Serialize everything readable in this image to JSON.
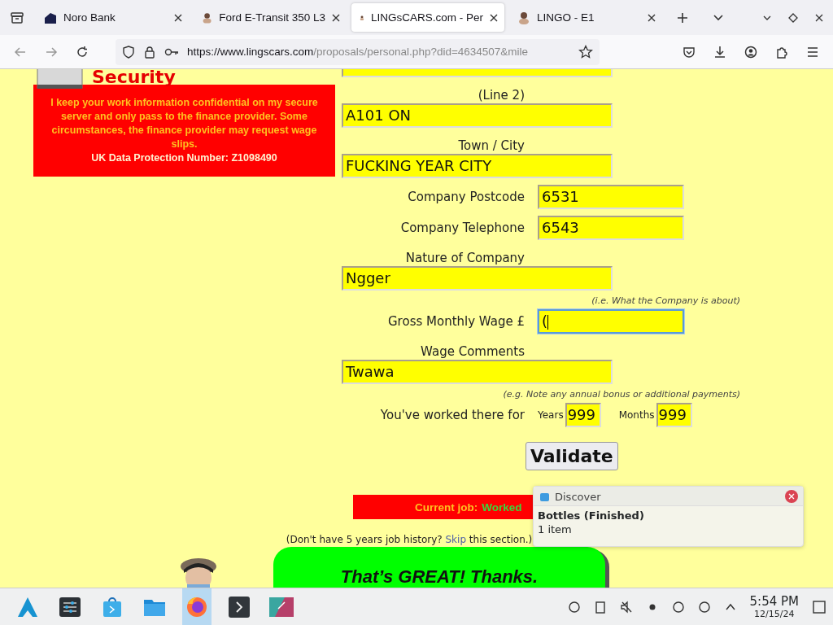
{
  "browser": {
    "tabs": [
      {
        "title": "Noro Bank",
        "selected": false
      },
      {
        "title": "Ford E-Transit 350 L3",
        "selected": false
      },
      {
        "title": "LINGsCARS.com - Per",
        "selected": true
      },
      {
        "title": "LINGO - E1",
        "selected": false
      }
    ],
    "url": {
      "host": "https://www.lingscars.com",
      "path": "/proposals/personal.php?did=4634507&mile"
    }
  },
  "security": {
    "heading": "Security",
    "text": "I keep your work information confidential on my secure server and only pass to the finance provider. Some circumstances, the finance provider may request wage slips.",
    "dp_number": "UK Data Protection Number: Z1098490"
  },
  "fields": [
    {
      "kind": "cut"
    },
    {
      "kind": "stacked",
      "label": "(Line 2)",
      "value": "A101 ON",
      "focused": false
    },
    {
      "kind": "stacked",
      "label": "Town / City",
      "value": "FUCKING YEAR CITY",
      "focused": false
    },
    {
      "kind": "inline",
      "label": "Company Postcode",
      "value": "6531",
      "focused": false
    },
    {
      "kind": "inline",
      "label": "Company Telephone",
      "value": "6543",
      "focused": false
    },
    {
      "kind": "stacked",
      "label": "Nature of Company",
      "value": "Ngger",
      "focused": false
    },
    {
      "kind": "hint",
      "text": "(i.e. What the Company is about)"
    },
    {
      "kind": "inline",
      "label": "Gross Monthly Wage £",
      "value": "(",
      "focused": true
    },
    {
      "kind": "stacked",
      "label": "Wage Comments",
      "value": "Twawa",
      "focused": false
    },
    {
      "kind": "hint",
      "text": "(e.g. Note any annual bonus or additional payments)"
    }
  ],
  "duration": {
    "label": "You've worked there for",
    "years_label": "Years",
    "years": "999",
    "months_label": "Months",
    "months": "999"
  },
  "validate_button": "Validate",
  "current_job": {
    "label": "Current job:",
    "value": "Worked"
  },
  "skip_note": {
    "before": "(Don't have 5 years job history?",
    "link": "Skip",
    "after": "this section.)"
  },
  "banner": "That’s GREAT! Thanks.",
  "notification": {
    "app": "Discover",
    "title": "Bottles (Finished)",
    "body": "1 item"
  },
  "taskbar": {
    "apps": [
      {
        "selected": false
      },
      {
        "selected": false
      },
      {
        "selected": false
      },
      {
        "selected": false
      },
      {
        "selected": true
      },
      {
        "selected": false
      },
      {
        "selected": false
      }
    ],
    "time": "5:54 PM",
    "date": "12/15/24"
  }
}
